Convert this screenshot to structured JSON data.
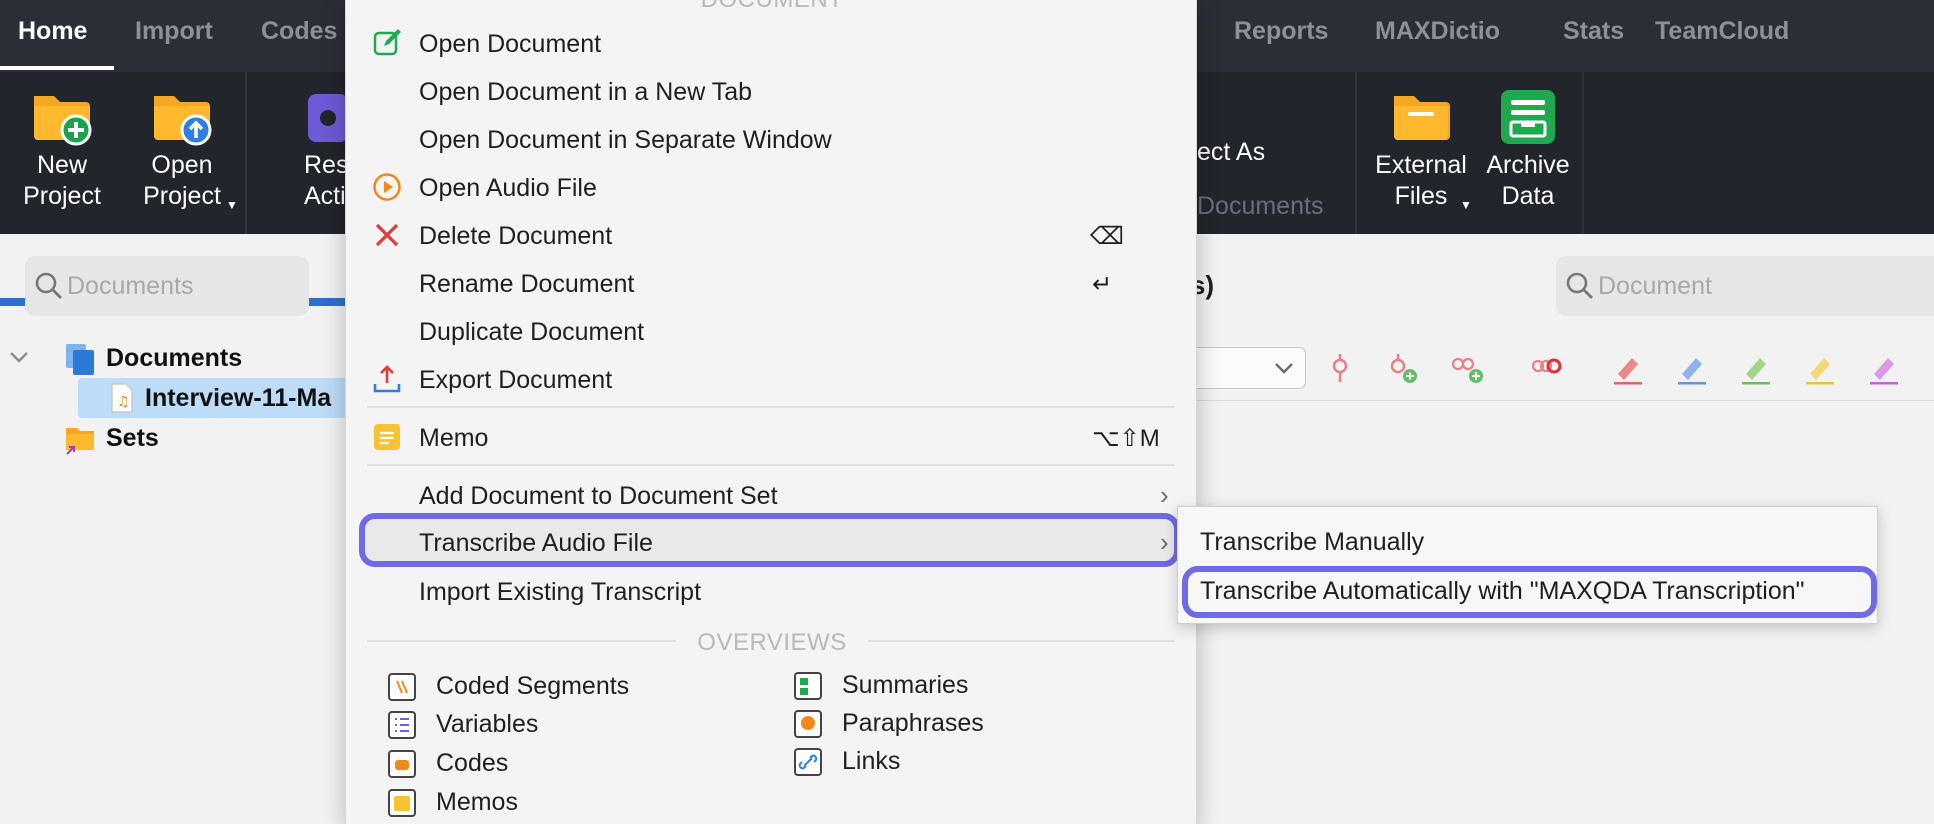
{
  "tabs": [
    {
      "label": "Home",
      "active": true
    },
    {
      "label": "Import",
      "active": false
    },
    {
      "label": "Codes",
      "active": false
    },
    {
      "label": "Reports",
      "active": false
    },
    {
      "label": "MAXDictio",
      "active": false
    },
    {
      "label": "Stats",
      "active": false
    },
    {
      "label": "TeamCloud",
      "active": false
    }
  ],
  "ribbon": {
    "new_project": "New\nProject",
    "open_project": "Open\nProject",
    "reset_fragment": "Res\nActiva",
    "project_as_fragment": "ect As",
    "documents_fragment": "Documents",
    "external_files": "External\nFiles",
    "archive_data": "Archive\nData"
  },
  "left_pane": {
    "search_placeholder": "Documents",
    "documents_label": "Documents",
    "document_item": "Interview-11-Ma",
    "sets_label": "Sets"
  },
  "right_pane": {
    "heading_fragment": "ns)",
    "search_placeholder": "Document"
  },
  "context_menu": {
    "section_document": "DOCUMENT",
    "items": [
      {
        "label": "Open Document",
        "icon": "edit-icon"
      },
      {
        "label": "Open Document in a New Tab"
      },
      {
        "label": "Open Document in Separate Window"
      },
      {
        "label": "Open Audio File",
        "icon": "play-circle-icon"
      },
      {
        "label": "Delete Document",
        "icon": "delete-x-icon",
        "shortcut": "⌫"
      },
      {
        "label": "Rename Document",
        "shortcut": "↵"
      },
      {
        "label": "Duplicate Document"
      },
      {
        "label": "Export Document",
        "icon": "export-icon"
      }
    ],
    "memo": {
      "label": "Memo",
      "shortcut": "⌥⇧M"
    },
    "add_to_set": "Add Document to Document Set",
    "transcribe": "Transcribe Audio File",
    "import_transcript": "Import Existing Transcript",
    "section_overviews": "OVERVIEWS",
    "overviews_left": [
      "Coded Segments",
      "Variables",
      "Codes",
      "Memos"
    ],
    "overviews_right": [
      "Summaries",
      "Paraphrases",
      "Links"
    ]
  },
  "submenu": {
    "manual": "Transcribe Manually",
    "automatic": "Transcribe Automatically with \"MAXQDA Transcription\""
  },
  "colors": {
    "highlight": "#6f6ae6",
    "ribbon_bg": "#22252c",
    "tabbar_bg": "#2b2e36",
    "selection": "#bcdcf7"
  }
}
